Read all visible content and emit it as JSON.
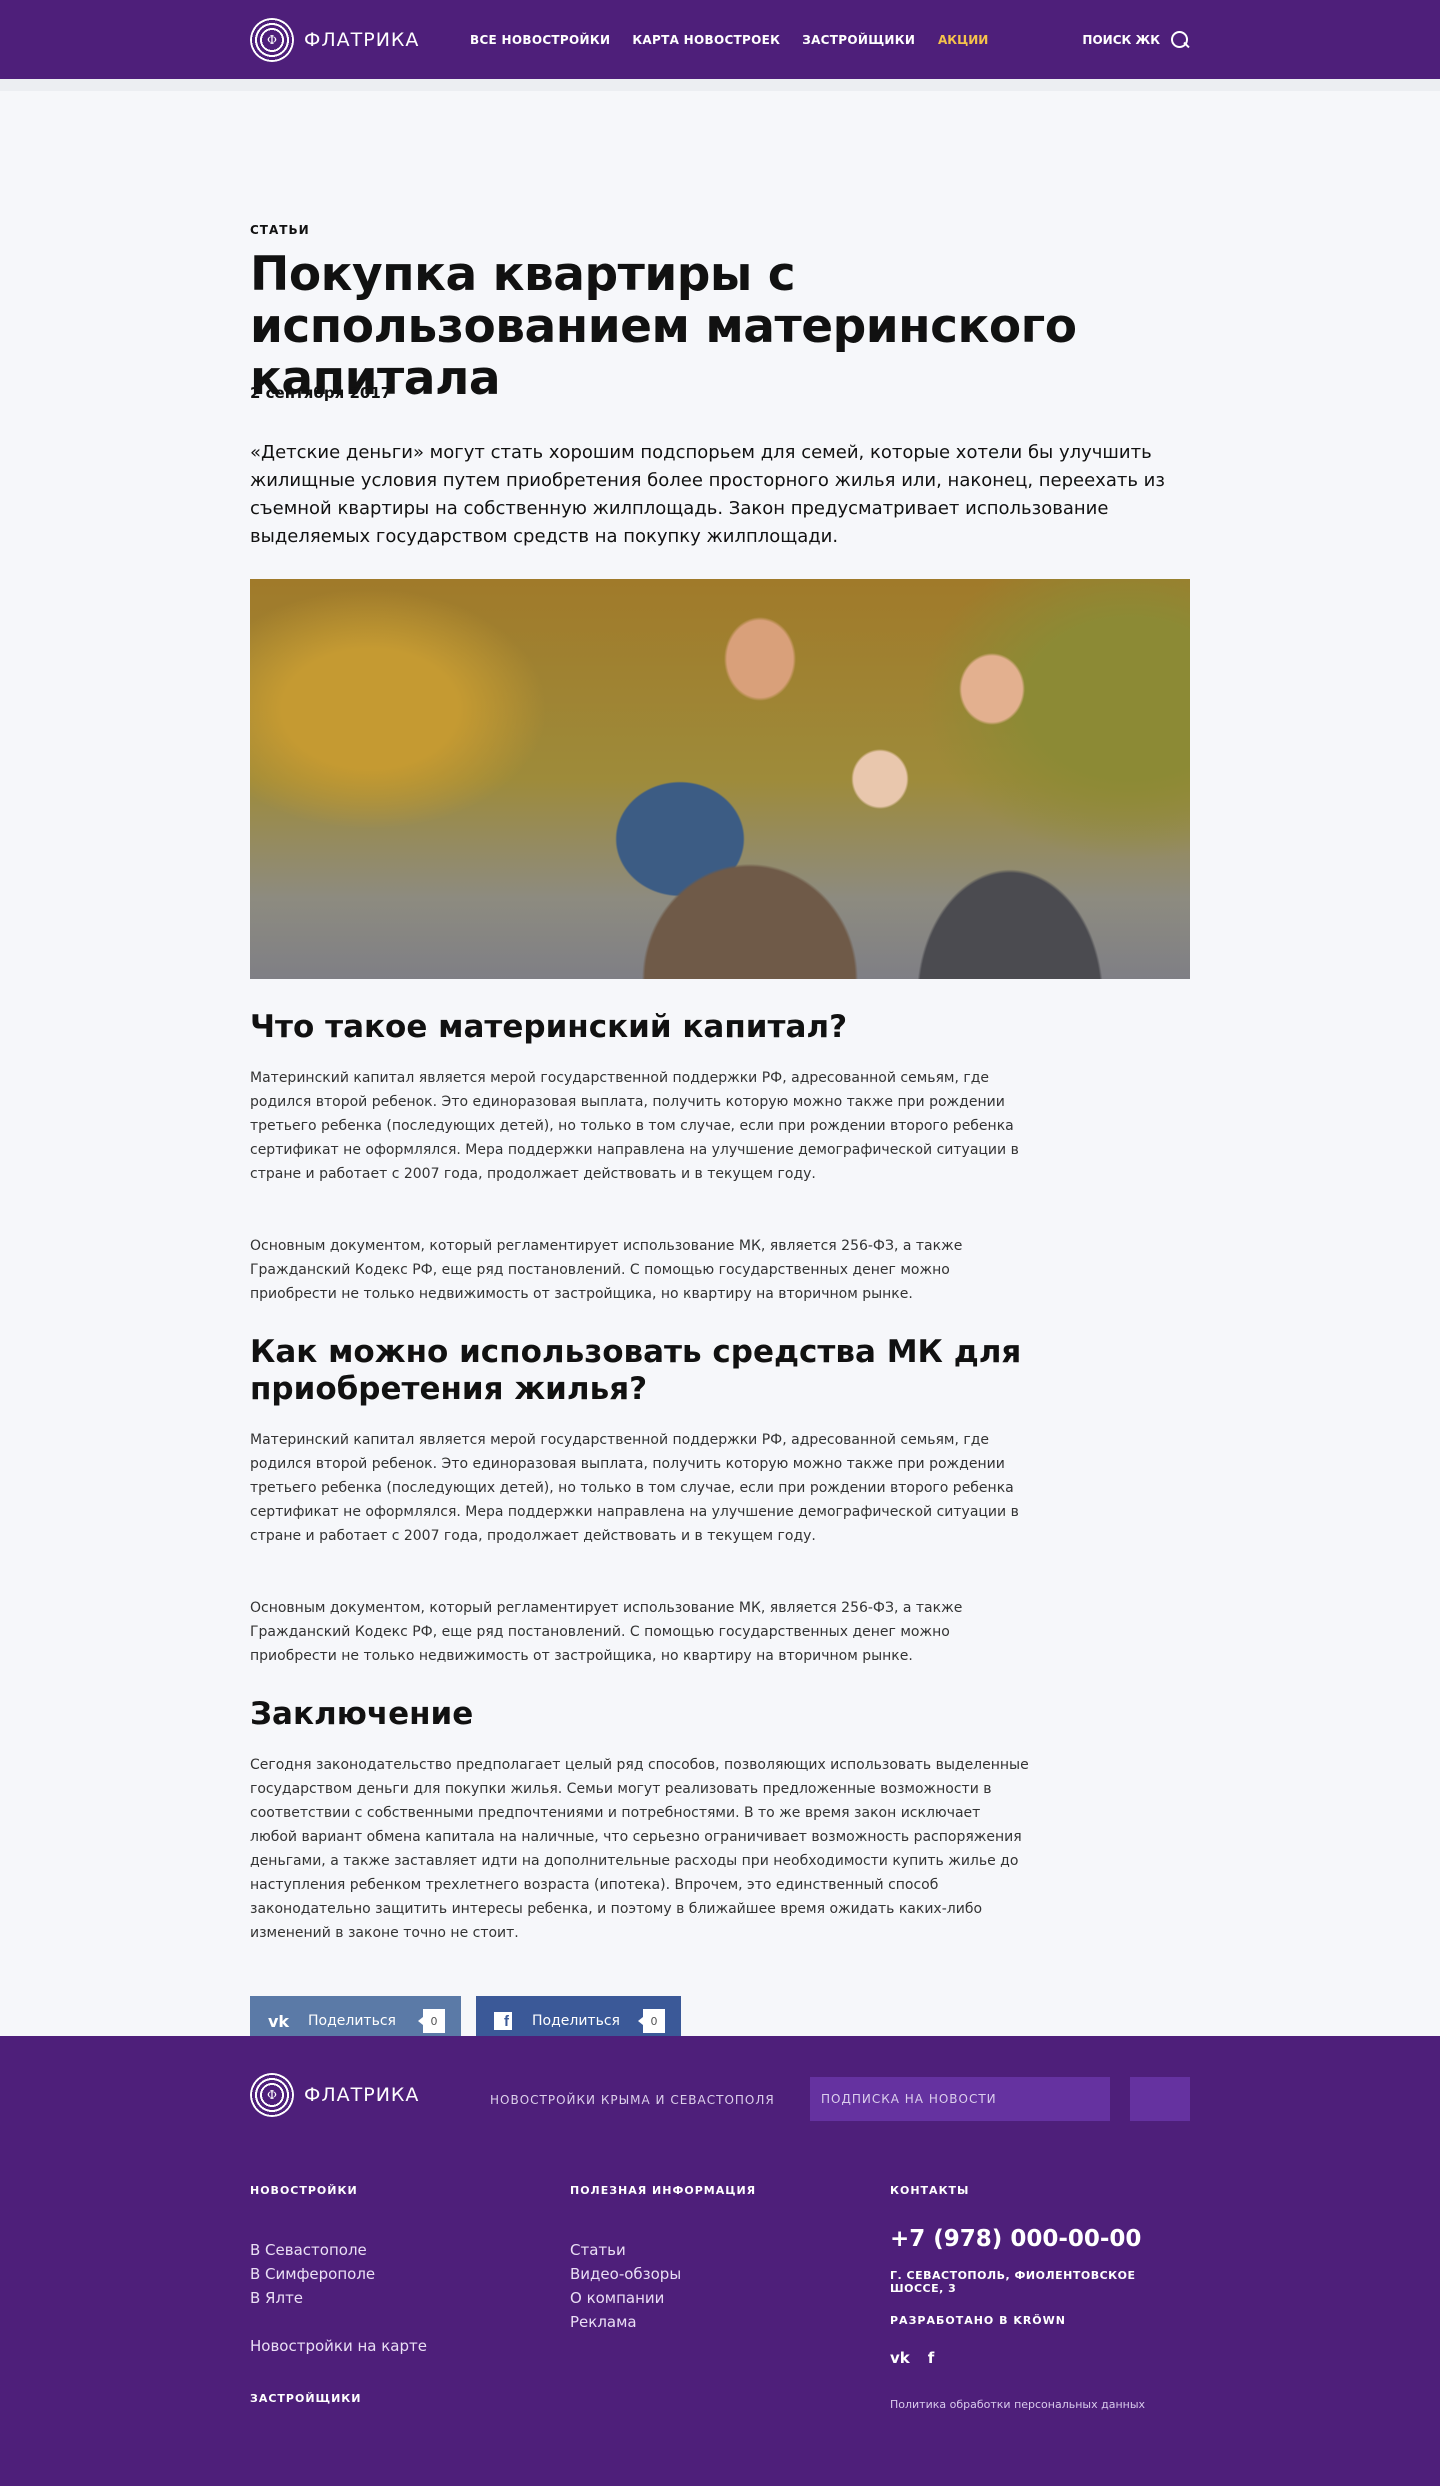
{
  "header": {
    "logo_text": "ФЛАТРИКА",
    "logo_letter": "Ф",
    "nav": [
      "ВСЕ НОВОСТРОЙКИ",
      "КАРТА НОВОСТРОЕК",
      "ЗАСТРОЙЩИКИ"
    ],
    "promo": "АКЦИИ",
    "search_label": "ПОИСК ЖК"
  },
  "article": {
    "category": "СТАТЬИ",
    "title": "Покупка квартиры с использованием материнского капитала",
    "date": "2 сентября 2017",
    "lead": "«Детские деньги» могут стать хорошим подспорьем для семей, которые хотели бы улучшить жилищные условия путем приобретения более просторного жилья или, наконец, переехать из съемной квартиры на собственную жилплощадь. Закон предусматривает использование выделяемых государством средств на покупку жилплощади.",
    "sections": [
      {
        "heading": "Что такое материнский капитал?",
        "paragraphs": [
          "Материнский капитал является мерой государственной поддержки РФ, адресованной семьям, где родился второй ребенок. Это единоразовая выплата, получить которую можно также при рождении третьего ребенка (последующих детей), но только в том случае, если при рождении второго ребенка сертификат не оформлялся. Мера поддержки направлена на улучшение демографической ситуации в стране и работает с 2007 года, продолжает действовать и в текущем году.",
          "Основным документом, который регламентирует использование МК, является 256-ФЗ, а также Гражданский Кодекс РФ, еще ряд постановлений. С помощью государственных денег можно приобрести не только недвижимость от застройщика, но  квартиру на вторичном рынке."
        ]
      },
      {
        "heading": "Как можно использовать средства МК для приобретения жилья?",
        "paragraphs": [
          "Материнский капитал является мерой государственной поддержки РФ, адресованной семьям, где родился второй ребенок. Это единоразовая выплата, получить которую можно также при рождении третьего ребенка (последующих детей), но только в том случае, если при рождении второго ребенка сертификат не оформлялся. Мера поддержки направлена на улучшение демографической ситуации в стране и работает с 2007 года, продолжает действовать и в текущем году.",
          "Основным документом, который регламентирует использование МК, является 256-ФЗ, а также Гражданский Кодекс РФ, еще ряд постановлений. С помощью государственных денег можно приобрести не только недвижимость от застройщика, но  квартиру на вторичном рынке."
        ]
      },
      {
        "heading": "Заключение",
        "paragraphs": [
          "Сегодня законодательство предполагает целый ряд способов, позволяющих использовать выделенные государством деньги для покупки жилья. Семьи могут реализовать предложенные возможности в соответствии с собственными предпочтениями и потребностями. В то же время закон исключает любой вариант обмена капитала на наличные, что серьезно ограничивает возможность распоряжения деньгами, а также заставляет идти на дополнительные расходы при необходимости купить жилье до наступления ребенком трехлетнего возраста (ипотека). Впрочем, это единственный способ законодательно защитить интересы ребенка, и поэтому в ближайшее время ожидать каких-либо изменений в законе точно не стоит."
        ]
      }
    ]
  },
  "share": {
    "vk": {
      "icon": "vk-icon",
      "label": "Поделиться",
      "count": "0",
      "color": "#5b7aa7"
    },
    "fb": {
      "icon": "facebook-icon",
      "label": "Поделиться",
      "count": "0",
      "color": "#3b5998"
    }
  },
  "footer": {
    "logo_text": "ФЛАТРИКА",
    "logo_letter": "Ф",
    "tagline": "НОВОСТРОЙКИ КРЫМА И СЕВАСТОПОЛЯ",
    "subscribe_placeholder": "ПОДПИСКА НА НОВОСТИ",
    "col1": {
      "heading": "НОВОСТРОЙКИ",
      "links": [
        "В Севастополе",
        "В Симферополе",
        "В Ялте"
      ],
      "map_link": "Новостройки на карте",
      "developers": "ЗАСТРОЙЩИКИ"
    },
    "col2": {
      "heading": "ПОЛЕЗНАЯ ИНФОРМАЦИЯ",
      "links": [
        "Статьи",
        "Видео-обзоры",
        "О компании",
        "Реклама"
      ]
    },
    "col3": {
      "heading": "КОНТАКТЫ",
      "phone": "+7 (978) 000-00-00",
      "address": "Г. СЕВАСТОПОЛЬ, ФИОЛЕНТОВСКОЕ ШОССЕ, 3",
      "made_by": "РАЗРАБОТАНО В KRÖWN",
      "social": {
        "vk": "vk",
        "fb": "f"
      },
      "policy": "Политика обработки персональных данных"
    }
  },
  "colors": {
    "brand": "#4e1f7a",
    "accent": "#f5c24b",
    "input_bg": "#6532a0"
  }
}
